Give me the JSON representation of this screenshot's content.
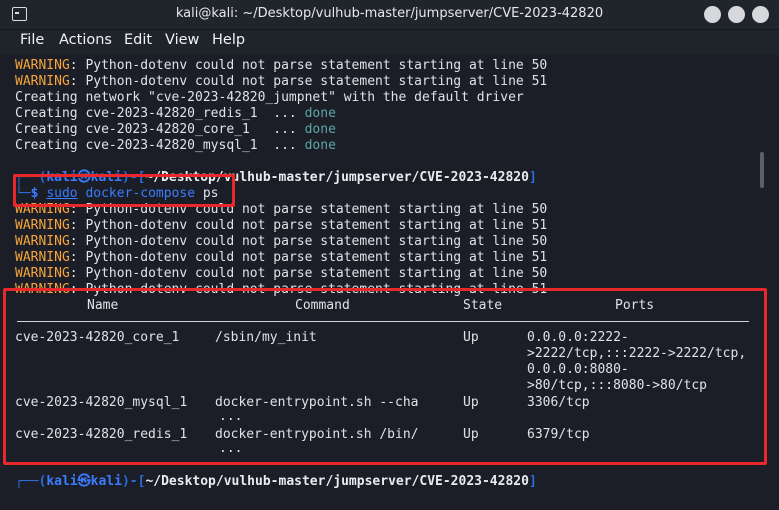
{
  "window": {
    "title": "kali@kali: ~/Desktop/vulhub-master/jumpserver/CVE-2023-42820",
    "menu": [
      "File",
      "Actions",
      "Edit",
      "View",
      "Help"
    ]
  },
  "output_top": [
    {
      "prefix": "WARNING",
      "rest": ": Python-dotenv could not parse statement starting at line 50"
    },
    {
      "prefix": "WARNING",
      "rest": ": Python-dotenv could not parse statement starting at line 51"
    },
    {
      "text": "Creating network \"cve-2023-42820_jumpnet\" with the default driver"
    },
    {
      "text": "Creating cve-2023-42820_redis_1  ... ",
      "status": "done"
    },
    {
      "text": "Creating cve-2023-42820_core_1   ... ",
      "status": "done"
    },
    {
      "text": "Creating cve-2023-42820_mysql_1  ... ",
      "status": "done"
    }
  ],
  "prompt": {
    "user": "kali",
    "at": "㉿",
    "host": "kali",
    "path": "~/Desktop/vulhub-master/jumpserver/CVE-2023-42820",
    "cmd_sudo": "sudo",
    "cmd_main": "docker-compose",
    "cmd_arg": "ps"
  },
  "warnings_after": [
    ": Python-dotenv could not parse statement starting at line 50",
    ": Python-dotenv could not parse statement starting at line 51",
    ": Python-dotenv could not parse statement starting at line 50",
    ": Python-dotenv could not parse statement starting at line 51",
    ": Python-dotenv could not parse statement starting at line 50",
    ": Python-dotenv could not parse statement starting at line 51"
  ],
  "warning_label": "WARNING",
  "table": {
    "headers": [
      "Name",
      "Command",
      "State",
      "Ports"
    ],
    "rows": [
      {
        "name": "cve-2023-42820_core_1",
        "command": [
          "/sbin/my_init"
        ],
        "state": "Up",
        "ports": [
          "0.0.0.0:2222-",
          ">2222/tcp,:::2222->2222/tcp,",
          "0.0.0.0:8080-",
          ">80/tcp,:::8080->80/tcp"
        ]
      },
      {
        "name": "cve-2023-42820_mysql_1",
        "command": [
          "docker-entrypoint.sh --cha",
          "..."
        ],
        "state": "Up",
        "ports": [
          "3306/tcp"
        ]
      },
      {
        "name": "cve-2023-42820_redis_1",
        "command": [
          "docker-entrypoint.sh /bin/",
          "..."
        ],
        "state": "Up",
        "ports": [
          "6379/tcp"
        ]
      }
    ]
  },
  "colors": {
    "warning": "#f5a53b",
    "done": "#5da7a6",
    "prompt": "#3b7cff",
    "annotation": "#e8282a"
  }
}
